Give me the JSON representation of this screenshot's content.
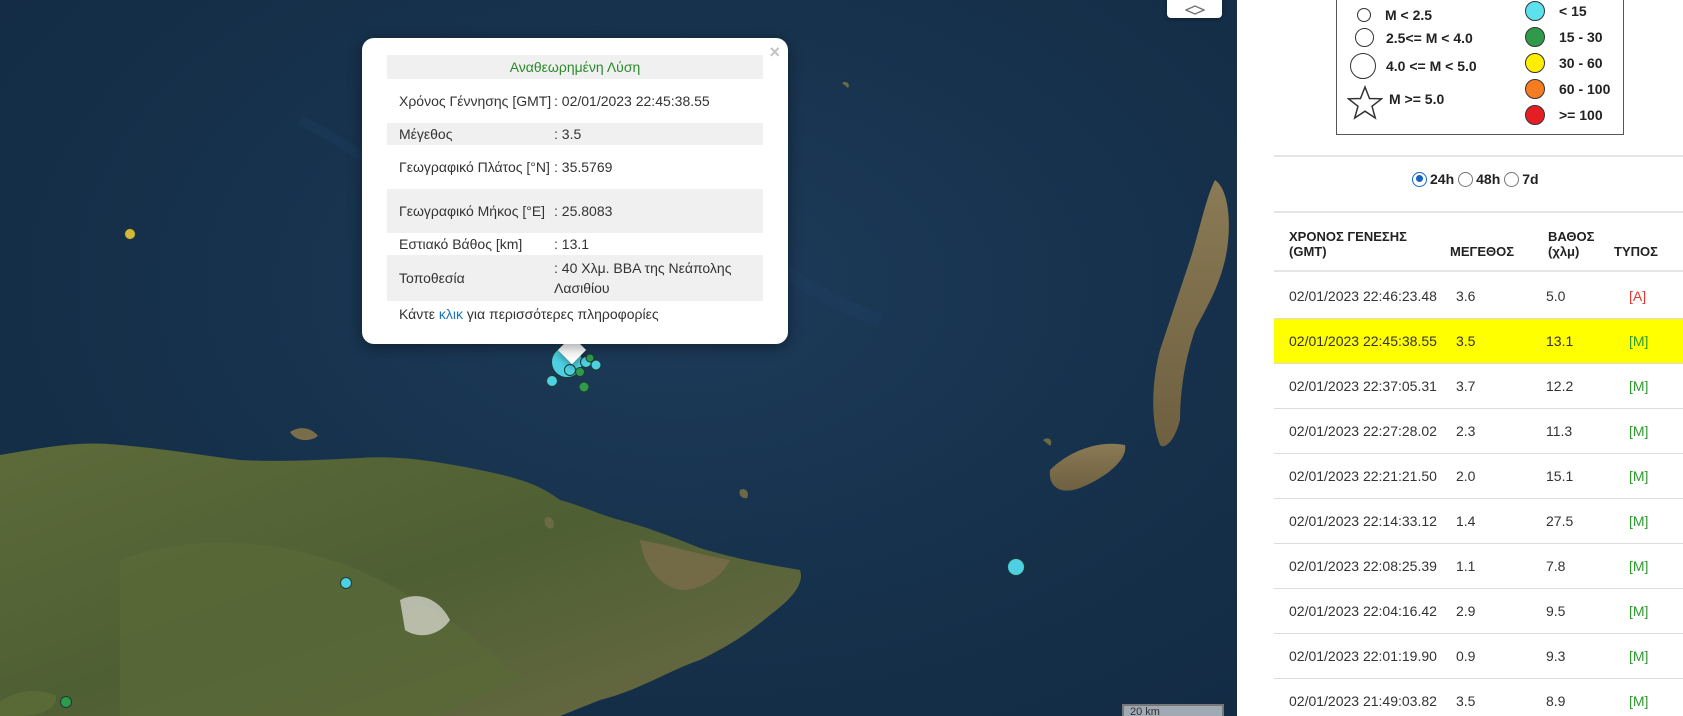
{
  "map": {
    "scale_label": "20 km",
    "markers": [
      {
        "depth_class": "shallow",
        "color": "#4dd0e1"
      },
      {
        "depth_class": "intermediate",
        "color": "#2e9a4a"
      },
      {
        "depth_class": "deep",
        "color": "#d4b73a"
      }
    ]
  },
  "popup": {
    "title": "Αναθεωρημένη Λύση",
    "close_label": "×",
    "rows": [
      {
        "label": "Χρόνος Γέννησης [GMT]",
        "value": ": 02/01/2023 22:45:38.55"
      },
      {
        "label": "Μέγεθος",
        "value": ": 3.5"
      },
      {
        "label": "Γεωγραφικό Πλάτος [°N]",
        "value": ": 35.5769"
      },
      {
        "label": "Γεωγραφικό Μήκος [°E]",
        "value": ": 25.8083"
      },
      {
        "label": "Εστιακό Βάθος [km]",
        "value": ": 13.1"
      },
      {
        "label": "Τοποθεσία",
        "value": ": 40 Χλμ. ΒΒΑ της Νεάπολης Λασιθίου"
      }
    ],
    "footer_before": "Κάντε ",
    "footer_link": "κλικ",
    "footer_after": " για περισσότερες πληροφορίες"
  },
  "legend": {
    "magnitudes": [
      "M < 2.5",
      "2.5<= M < 4.0",
      "4.0 <= M < 5.0",
      "M >= 5.0"
    ],
    "depths": [
      {
        "label": "< 15",
        "color": "#5ce1ee"
      },
      {
        "label": "15 - 30",
        "color": "#2e9a4a"
      },
      {
        "label": "30 - 60",
        "color": "#ffee00"
      },
      {
        "label": "60 - 100",
        "color": "#f57c21"
      },
      {
        "label": ">= 100",
        "color": "#e51e25"
      }
    ]
  },
  "filters": {
    "options": [
      "24h",
      "48h",
      "7d"
    ],
    "selected": "24h"
  },
  "table": {
    "headers": {
      "time_line1": "ΧΡΟΝΟΣ ΓΕΝΕΣΗΣ",
      "time_line2": "(GMT)",
      "magnitude": "ΜΕΓΕΘΟΣ",
      "depth_line1": "ΒΑΘΟΣ",
      "depth_line2": "(χλμ)",
      "type": "ΤΥΠΟΣ"
    },
    "rows": [
      {
        "time": "02/01/2023 22:46:23.48",
        "mag": "3.6",
        "depth": "5.0",
        "type": "[A]",
        "type_code": "A",
        "selected": false
      },
      {
        "time": "02/01/2023 22:45:38.55",
        "mag": "3.5",
        "depth": "13.1",
        "type": "[M]",
        "type_code": "M",
        "selected": true
      },
      {
        "time": "02/01/2023 22:37:05.31",
        "mag": "3.7",
        "depth": "12.2",
        "type": "[M]",
        "type_code": "M",
        "selected": false
      },
      {
        "time": "02/01/2023 22:27:28.02",
        "mag": "2.3",
        "depth": "11.3",
        "type": "[M]",
        "type_code": "M",
        "selected": false
      },
      {
        "time": "02/01/2023 22:21:21.50",
        "mag": "2.0",
        "depth": "15.1",
        "type": "[M]",
        "type_code": "M",
        "selected": false
      },
      {
        "time": "02/01/2023 22:14:33.12",
        "mag": "1.4",
        "depth": "27.5",
        "type": "[M]",
        "type_code": "M",
        "selected": false
      },
      {
        "time": "02/01/2023 22:08:25.39",
        "mag": "1.1",
        "depth": "7.8",
        "type": "[M]",
        "type_code": "M",
        "selected": false
      },
      {
        "time": "02/01/2023 22:04:16.42",
        "mag": "2.9",
        "depth": "9.5",
        "type": "[M]",
        "type_code": "M",
        "selected": false
      },
      {
        "time": "02/01/2023 22:01:19.90",
        "mag": "0.9",
        "depth": "9.3",
        "type": "[M]",
        "type_code": "M",
        "selected": false
      },
      {
        "time": "02/01/2023 21:49:03.82",
        "mag": "3.5",
        "depth": "8.9",
        "type": "[M]",
        "type_code": "M",
        "selected": false
      }
    ]
  }
}
